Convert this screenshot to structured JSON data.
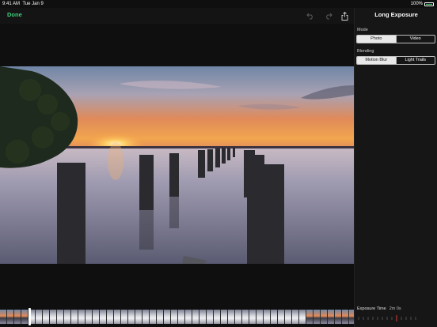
{
  "status_bar": {
    "time": "9:41 AM",
    "date": "Tue Jan 9",
    "battery": "100%"
  },
  "toolbar": {
    "done_label": "Done"
  },
  "panel": {
    "title": "Long Exposure",
    "mode": {
      "label": "Mode",
      "options": [
        "Photo",
        "Video"
      ],
      "selected": "Photo"
    },
    "blending": {
      "label": "Blending",
      "options": [
        "Motion Blur",
        "Light Trails"
      ],
      "selected": "Motion Blur"
    },
    "exposure": {
      "label": "Exposure Time",
      "value": "2m 0s"
    }
  },
  "colors": {
    "accent": "#3fcf7a",
    "battery": "#3ad16a"
  },
  "icons": [
    "undo-icon",
    "redo-icon",
    "share-icon"
  ]
}
